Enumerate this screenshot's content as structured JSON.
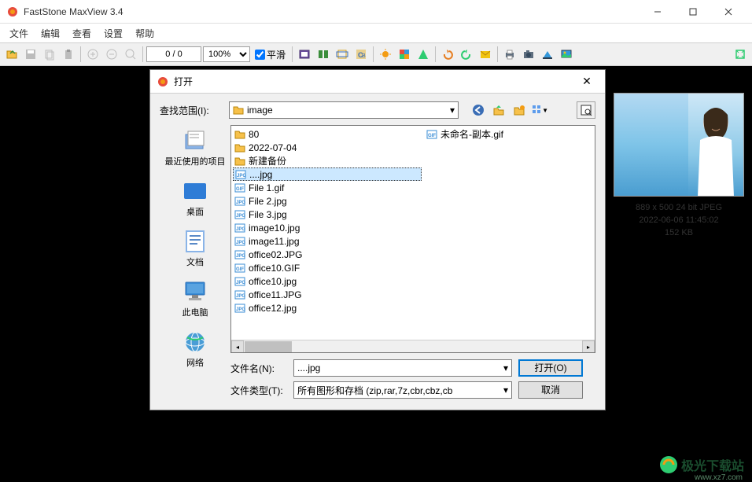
{
  "app": {
    "title": "FastStone MaxView 3.4"
  },
  "menu": {
    "items": [
      "文件",
      "编辑",
      "查看",
      "设置",
      "帮助"
    ]
  },
  "toolbar": {
    "page_counter": "0 / 0",
    "zoom": "100%",
    "smooth_label": "平滑"
  },
  "dialog": {
    "title": "打开",
    "lookin_label": "查找范围(I):",
    "lookin_value": "image",
    "places": [
      {
        "label": "最近使用的项目"
      },
      {
        "label": "桌面"
      },
      {
        "label": "文档"
      },
      {
        "label": "此电脑"
      },
      {
        "label": "网络"
      }
    ],
    "files_col1": [
      {
        "name": "80",
        "type": "folder"
      },
      {
        "name": "2022-07-04",
        "type": "folder"
      },
      {
        "name": "新建备份",
        "type": "folder"
      },
      {
        "name": "....jpg",
        "type": "jpg",
        "selected": true
      },
      {
        "name": "File 1.gif",
        "type": "gif"
      },
      {
        "name": "File 2.jpg",
        "type": "jpg"
      },
      {
        "name": "File 3.jpg",
        "type": "jpg"
      },
      {
        "name": "image10.jpg",
        "type": "jpg"
      },
      {
        "name": "image11.jpg",
        "type": "jpg"
      },
      {
        "name": "office02.JPG",
        "type": "jpg"
      },
      {
        "name": "office10.GIF",
        "type": "gif"
      },
      {
        "name": "office10.jpg",
        "type": "jpg"
      },
      {
        "name": "office11.JPG",
        "type": "jpg"
      },
      {
        "name": "office12.jpg",
        "type": "jpg"
      }
    ],
    "files_col2": [
      {
        "name": "未命名-副本.gif",
        "type": "gif"
      }
    ],
    "filename_label": "文件名(N):",
    "filename_value": "....jpg",
    "filetype_label": "文件类型(T):",
    "filetype_value": "所有图形和存档 (zip,rar,7z,cbr,cbz,cb",
    "open_btn": "打开(O)",
    "cancel_btn": "取消"
  },
  "preview": {
    "line1": "889 x 500   24 bit   JPEG",
    "line2": "2022-06-06 11:45:02",
    "line3": "152 KB"
  },
  "watermark": {
    "text": "极光下载站",
    "sub": "www.xz7.com"
  }
}
